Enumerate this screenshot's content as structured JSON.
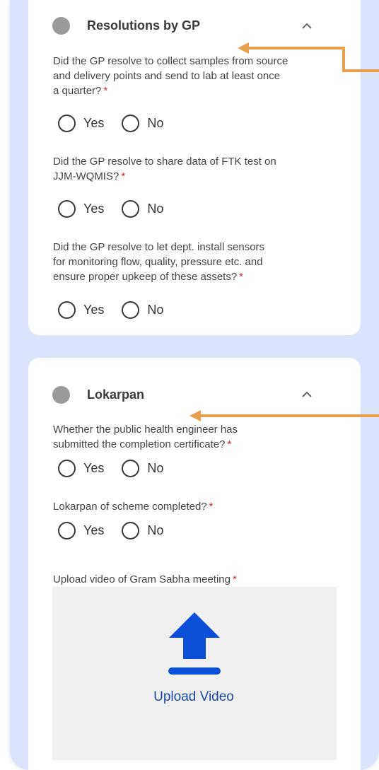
{
  "sections": [
    {
      "title": "Resolutions by GP",
      "questions": [
        {
          "text_lines": [
            "Did the GP resolve to collect samples from source",
            "and delivery points and send to lab at least once",
            "a quarter?"
          ],
          "required_mark": "*",
          "options": [
            "Yes",
            "No"
          ]
        },
        {
          "text_lines": [
            "Did the GP resolve to share data of FTK test on",
            "JJM-WQMIS?"
          ],
          "required_mark": "*",
          "options": [
            "Yes",
            "No"
          ]
        },
        {
          "text_lines": [
            "Did the GP resolve to let dept. install sensors",
            "for monitoring flow, quality, pressure etc. and",
            "ensure proper upkeep of these assets?"
          ],
          "required_mark": "*",
          "options": [
            "Yes",
            "No"
          ]
        }
      ]
    },
    {
      "title": "Lokarpan",
      "questions": [
        {
          "text_lines": [
            "Whether the public health engineer has",
            "submitted the completion certificate?"
          ],
          "required_mark": "*",
          "options": [
            "Yes",
            "No"
          ]
        },
        {
          "text_lines": [
            "Lokarpan of scheme completed?"
          ],
          "required_mark": "*",
          "options": [
            "Yes",
            "No"
          ]
        }
      ],
      "upload": {
        "label_text": "Upload video of Gram Sabha meeting",
        "required_mark": "*",
        "button_label": "Upload Video"
      }
    }
  ],
  "colors": {
    "frame_bg": "#dbe4fb",
    "card_bg": "#ffffff",
    "status_dot": "#9a9a9a",
    "required": "#d22b2b",
    "annotation_arrow": "#e8a04e",
    "upload_icon": "#0a4fd6",
    "upload_text": "#1a47a8",
    "upload_box": "#f0f0f0"
  },
  "icons": {
    "status": "status-dot-icon",
    "collapse": "chevron-up-icon",
    "radio": "radio-unchecked-icon",
    "upload": "upload-arrow-icon"
  }
}
